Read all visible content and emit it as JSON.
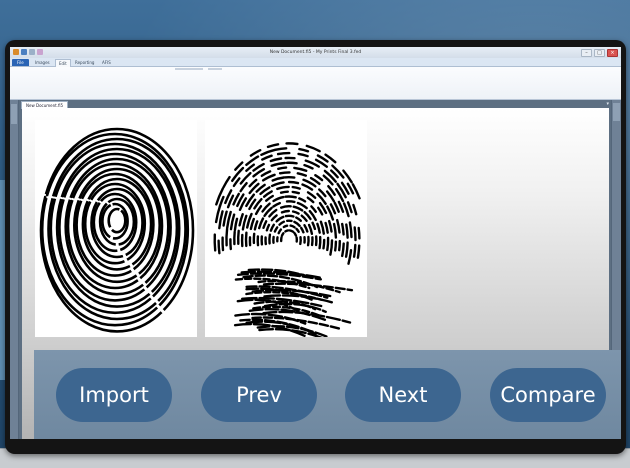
{
  "window": {
    "title": "New Document.fi5 - My Prints Final 3.fed",
    "controls": {
      "minimize": "–",
      "maximize": "□",
      "close": "×"
    }
  },
  "ribbon": {
    "tabs": [
      "File",
      "Images",
      "Edit",
      "Reporting",
      "AFIS"
    ],
    "active_tab": "Edit"
  },
  "document": {
    "tab_label": "New Document.fi5",
    "tab_menu_glyph": "▾"
  },
  "images": [
    {
      "name": "fingerprint-whorl",
      "kind": "ink rolled print"
    },
    {
      "name": "fingerprint-latent",
      "kind": "latent print"
    }
  ],
  "controls": {
    "import_label": "Import",
    "prev_label": "Prev",
    "next_label": "Next",
    "compare_label": "Compare"
  },
  "colors": {
    "button_bg": "#3d6690",
    "control_band": "#7d95ac",
    "file_tab": "#2a64b5",
    "background": "#2a567d"
  },
  "icons": [
    "save-icon",
    "undo-icon",
    "redo-icon",
    "minimize-icon",
    "maximize-icon",
    "close-icon"
  ]
}
